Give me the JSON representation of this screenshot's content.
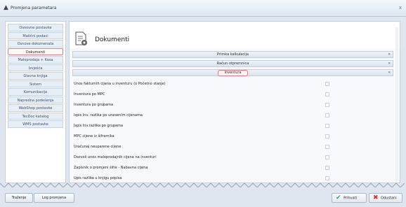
{
  "window": {
    "title": "Promjena parametara",
    "close_glyph": "x"
  },
  "sidebar": {
    "items": [
      {
        "label": "Osnovne postavke"
      },
      {
        "label": "Matični podaci"
      },
      {
        "label": "Osnove dokumenata"
      },
      {
        "label": "Dokumenti"
      },
      {
        "label": "Maloprodaja + Kasa"
      },
      {
        "label": "Izvješća"
      },
      {
        "label": "Glavna knjiga"
      },
      {
        "label": "Sistem"
      },
      {
        "label": "Komunikacija"
      },
      {
        "label": "Napredna podešenja"
      },
      {
        "label": "WebShop postavke"
      },
      {
        "label": "TecDoc katalog"
      },
      {
        "label": "WMS postavke"
      }
    ],
    "active_index": 3
  },
  "main": {
    "heading": "Dokumenti",
    "sections": [
      {
        "label": "Primka kalkulacija",
        "chevron": "»"
      },
      {
        "label": "Račun otpremnica",
        "chevron": "»"
      },
      {
        "label": "Inventura",
        "chevron": "«"
      }
    ],
    "options": [
      {
        "label": "Unos fakturnih cijena u inventuru (u Početno stanje)",
        "checked": false
      },
      {
        "label": "Inventura po MPC",
        "checked": false
      },
      {
        "label": "Inventura po grupama",
        "checked": false
      },
      {
        "label": "Ispis Inv. razlika po unesenim cijenama",
        "checked": false
      },
      {
        "label": "Ispis Inv.razlika po grupama",
        "checked": false
      },
      {
        "label": "MPC cijene iz šifrarnika",
        "checked": false
      },
      {
        "label": "Uračunaj neuparene cijene",
        "checked": false
      },
      {
        "label": "Dozvoli unos maloprodajnih cijena na inventuri",
        "checked": false
      },
      {
        "label": "Zapisnik o promjeni šifre - Nabavna cijena",
        "checked": false
      },
      {
        "label": "Upis razlika u knjigu popisa",
        "checked": false
      }
    ]
  },
  "footer": {
    "search_label": "Traženje",
    "log_label": "Log promjena",
    "accept_label": "Prihvati",
    "cancel_label": "Odustani"
  },
  "icons": {
    "accept": "check-icon",
    "cancel": "x-icon",
    "document": "document-gear-icon"
  },
  "colors": {
    "active_border": "#e07a84",
    "accept_green": "#3aa53a",
    "cancel_red": "#d8312b"
  }
}
